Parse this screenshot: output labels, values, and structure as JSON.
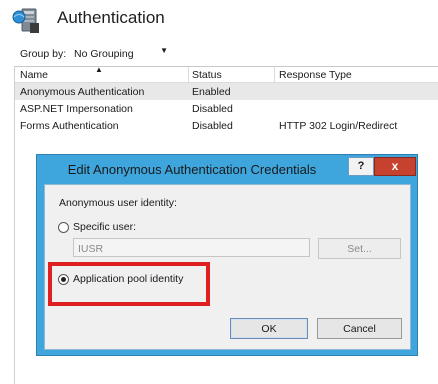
{
  "header": {
    "title": "Authentication",
    "icon": "authentication-icon"
  },
  "groupby": {
    "label": "Group by:",
    "value": "No Grouping"
  },
  "table": {
    "columns": [
      "Name",
      "Status",
      "Response Type"
    ],
    "rows": [
      {
        "name": "Anonymous Authentication",
        "status": "Enabled",
        "response": ""
      },
      {
        "name": "ASP.NET Impersonation",
        "status": "Disabled",
        "response": ""
      },
      {
        "name": "Forms Authentication",
        "status": "Disabled",
        "response": "HTTP 302 Login/Redirect"
      }
    ],
    "selected_row": 0
  },
  "dialog": {
    "title": "Edit Anonymous Authentication Credentials",
    "help_label": "?",
    "close_label": "x",
    "identity_label": "Anonymous user identity:",
    "specific_user_label": "Specific user:",
    "user_value": "IUSR",
    "set_label": "Set...",
    "app_pool_label": "Application pool identity",
    "selected_option": "app_pool",
    "ok_label": "OK",
    "cancel_label": "Cancel"
  },
  "colors": {
    "dialog_frame": "#3ea6dd",
    "close_button": "#c7412f",
    "highlight": "#e02020"
  }
}
